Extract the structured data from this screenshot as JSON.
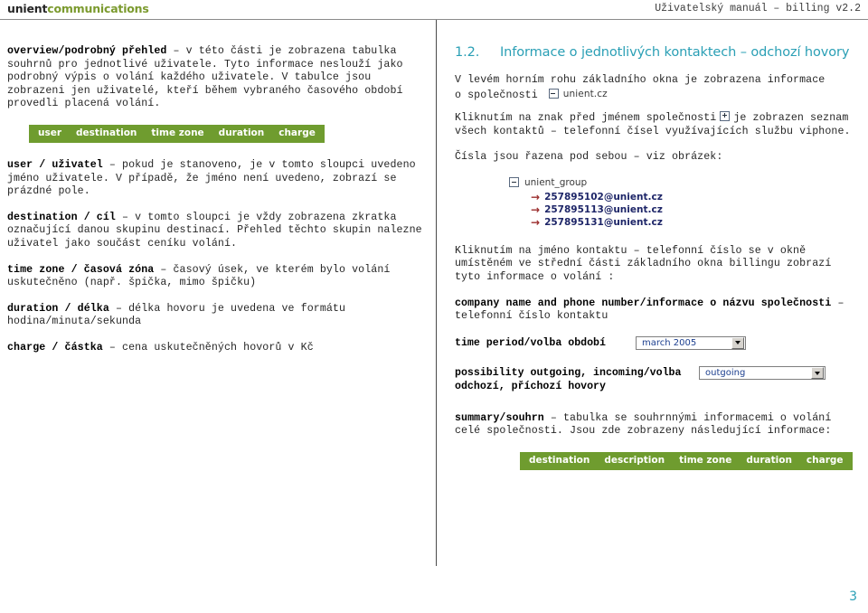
{
  "header": {
    "logo_primary": "unient",
    "logo_secondary": "communications",
    "doc_title": "Uživatelský manuál – billing v2.2"
  },
  "left_column": {
    "intro_bold": "overview/podrobný přehled",
    "intro_rest": " – v této části je zobrazena tabulka souhrnů pro jednotlivé uživatele. Tyto informace neslouží jako podrobný výpis o volání každého uživatele. V tabulce jsou zobrazeni jen uživatelé, kteří během vybraného časového období provedli placená volání.",
    "table_columns": [
      "user",
      "destination",
      "time zone",
      "duration",
      "charge"
    ],
    "definitions": [
      {
        "term": "user / uživatel",
        "body": " – pokud je stanoveno, je v tomto sloupci uvedeno jméno uživatele. V případě, že jméno není uvedeno, zobrazí se prázdné pole."
      },
      {
        "term": "destination / cíl",
        "body": " – v tomto sloupci je vždy zobrazena zkratka označující danou skupinu destinací. Přehled těchto skupin nalezne uživatel jako součást ceníku volání."
      },
      {
        "term": "time zone / časová zóna",
        "body": " – časový úsek, ve kterém bylo volání uskutečněno (např. špička, mimo špičku)"
      },
      {
        "term": "duration / délka",
        "body": " – délka hovoru je uvedena ve formátu hodina/minuta/sekunda"
      },
      {
        "term": "charge / částka",
        "body": " – cena uskutečněných hovorů v Kč"
      }
    ]
  },
  "right_column": {
    "section_number": "1.2.",
    "section_title": "Informace o jednotlivých kontaktech – odchozí hovory",
    "para_company_a": "V levém horním rohu základního okna je zobrazena informace",
    "para_company_b": "o společnosti",
    "company_node_label": "unient.cz",
    "para_click_a": "Kliknutím na znak před jménem společnosti",
    "para_click_b": "je zobrazen seznam všech kontaktů – telefonní čísel využívajících službu viphone.",
    "para_sorted": "Čísla jsou řazena pod sebou – viz obrázek:",
    "tree": {
      "root_label": "unient_group",
      "children": [
        "257895102@unient.cz",
        "257895113@unient.cz",
        "257895131@unient.cz"
      ]
    },
    "para_contact": "Kliknutím na jméno kontaktu – telefonní číslo se v okně umístěném ve střední části základního okna billingu zobrazí tyto informace o volání :",
    "def_company": {
      "term": "company name and phone number/informace o názvu společnosti",
      "body": " – telefonní číslo kontaktu"
    },
    "field_period_label": "time period/volba období",
    "field_period_value": "march 2005",
    "field_direction_label": "possibility outgoing, incoming/volba odchozí, příchozí hovory",
    "field_direction_value": "outgoing",
    "def_summary": {
      "term": "summary/souhrn",
      "body": "  – tabulka se souhrnnými informacemi o volání celé společnosti. Jsou zde zobrazeny následující informace:"
    },
    "summary_table_columns": [
      "destination",
      "description",
      "time zone",
      "duration",
      "charge"
    ]
  },
  "footer": {
    "page_number": "3"
  }
}
